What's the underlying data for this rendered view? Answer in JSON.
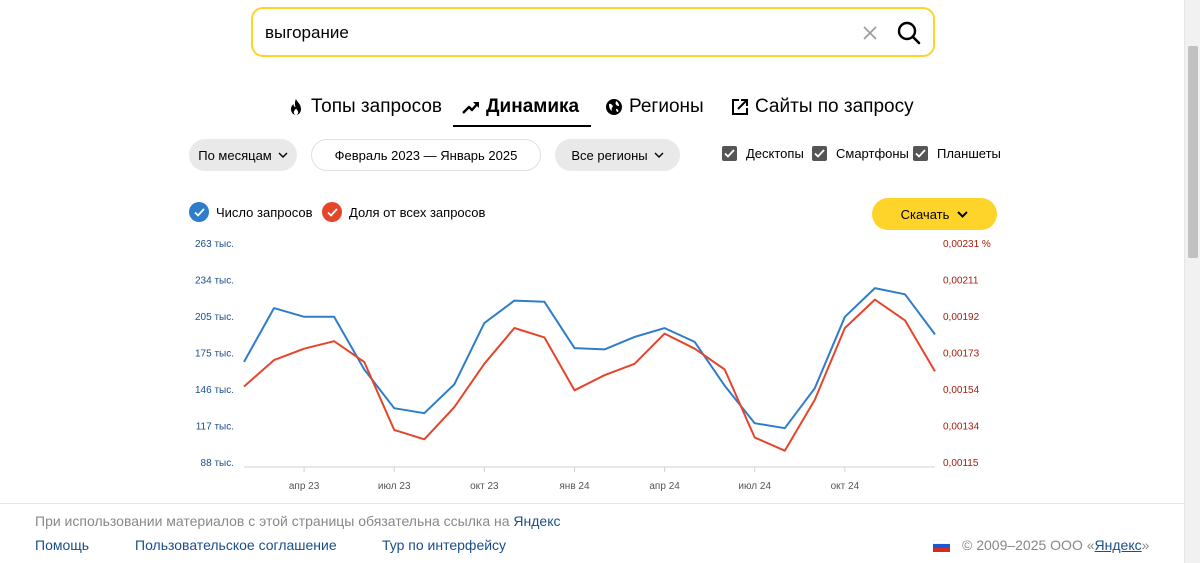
{
  "search": {
    "value": "выгорание"
  },
  "tabs": [
    {
      "label": "Топы запросов",
      "icon": "fire-icon"
    },
    {
      "label": "Динамика",
      "icon": "trend-icon",
      "active": true
    },
    {
      "label": "Регионы",
      "icon": "globe-icon"
    },
    {
      "label": "Сайты по запросу",
      "icon": "external-link-icon"
    }
  ],
  "filters": {
    "period": "По месяцам",
    "range": "Февраль 2023 — Январь 2025",
    "region": "Все регионы",
    "devices": [
      "Десктопы",
      "Смартфоны",
      "Планшеты"
    ]
  },
  "legend": {
    "count_label": "Число запросов",
    "share_label": "Доля от всех запросов",
    "count_color": "#2d7dca",
    "share_color": "#e5452a"
  },
  "download_label": "Скачать",
  "chart_data": {
    "type": "line",
    "left_ticks": [
      "263 тыс.",
      "234 тыс.",
      "205 тыс.",
      "175 тыс.",
      "146 тыс.",
      "117 тыс.",
      "88 тыс."
    ],
    "right_ticks": [
      "0,00231 %",
      "0,00211",
      "0,00192",
      "0,00173",
      "0,00154",
      "0,00134",
      "0,00115"
    ],
    "x_ticks": [
      "апр 23",
      "июл 23",
      "окт 23",
      "янв 24",
      "апр 24",
      "июл 24",
      "окт 24"
    ],
    "x": [
      "2023-02",
      "2023-03",
      "2023-04",
      "2023-05",
      "2023-06",
      "2023-07",
      "2023-08",
      "2023-09",
      "2023-10",
      "2023-11",
      "2023-12",
      "2024-01",
      "2024-02",
      "2024-03",
      "2024-04",
      "2024-05",
      "2024-06",
      "2024-07",
      "2024-08",
      "2024-09",
      "2024-10",
      "2024-11",
      "2024-12",
      "2025-01"
    ],
    "left_range": [
      88,
      263
    ],
    "right_range": [
      0.00115,
      0.00231
    ],
    "series": [
      {
        "name": "Число запросов",
        "axis": "left",
        "unit": "тыс.",
        "values": [
          168,
          211,
          204,
          204,
          162,
          131,
          127,
          150,
          199,
          217,
          216,
          179,
          178,
          188,
          195,
          184,
          149,
          119,
          115,
          147,
          204,
          227,
          222,
          190
        ]
      },
      {
        "name": "Доля от всех запросов",
        "axis": "left_scaled",
        "unit": "%",
        "values": [
          0.00155,
          0.00169,
          0.00175,
          0.00179,
          0.00168,
          0.00132,
          0.00127,
          0.00144,
          0.00167,
          0.00186,
          0.00181,
          0.00153,
          0.00161,
          0.00167,
          0.00183,
          0.00175,
          0.00164,
          0.00128,
          0.00121,
          0.00148,
          0.00186,
          0.00201,
          0.0019,
          0.00163
        ]
      }
    ]
  },
  "footer": {
    "note_prefix": "При использовании материалов с этой страницы обязательна ссылка на",
    "note_link": "Яндекс",
    "links": [
      "Помощь",
      "Пользовательское соглашение",
      "Тур по интерфейсу"
    ],
    "copyright_prefix": "© 2009–2025 ООО «",
    "copyright_link": "Яндекс",
    "copyright_suffix": "»"
  }
}
